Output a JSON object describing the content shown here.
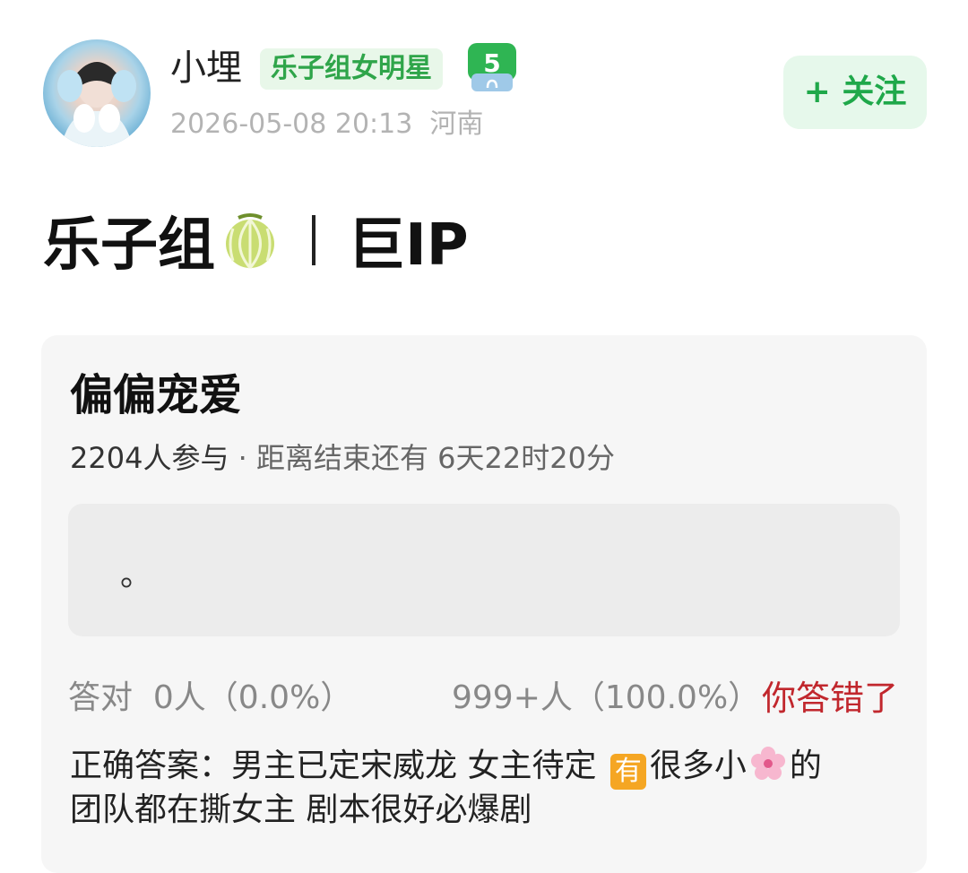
{
  "header": {
    "username": "小埋",
    "badge": "乐子组女明星",
    "level": "5",
    "date": "2026-05-08 20:13",
    "location": "河南",
    "follow_label": "+ 关注"
  },
  "post": {
    "title_prefix": "乐子组",
    "title_suffix": "巨IP"
  },
  "poll": {
    "title": "偏偏宠爱",
    "participants": "2204人参与",
    "countdown": " · 距离结束还有 6天22时20分",
    "option_text": "。",
    "correct_label": "答对",
    "correct_value": "0人（0.0%）",
    "other_value": "999+人（100.0%）",
    "wrong_text": "你答错了",
    "answer_line1a": "正确答案：男主已定宋威龙 女主待定 ",
    "answer_emoji_you": "有",
    "answer_line1b": "很多小",
    "answer_line1c": "的",
    "answer_line2": "团队都在撕女主 剧本很好必爆剧"
  },
  "colors": {
    "accent_green": "#1fa84a",
    "badge_green": "#2fa54a",
    "wrong_red": "#c1272d",
    "card_bg": "#f6f6f6"
  },
  "icons": [
    "avatar",
    "level-badge-icon",
    "melon-icon",
    "cherry-blossom-icon"
  ]
}
